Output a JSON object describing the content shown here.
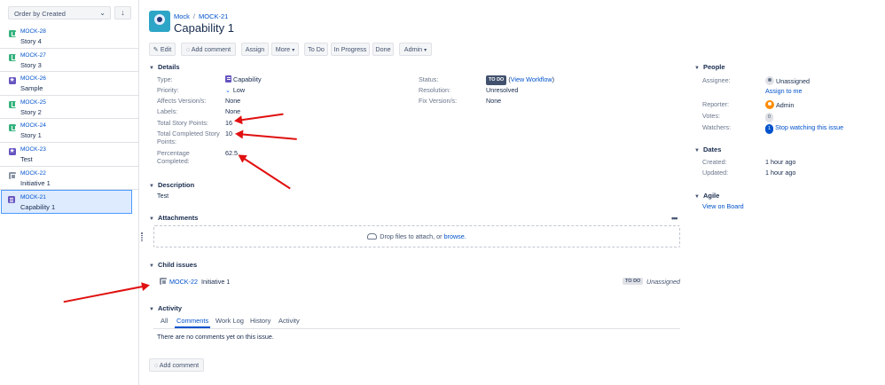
{
  "sidebar": {
    "order_label": "Order by Created",
    "order_direction_icon": "arrow-down-icon",
    "issues": [
      {
        "key": "MOCK-28",
        "summary": "Story 4",
        "type": "story"
      },
      {
        "key": "MOCK-27",
        "summary": "Story 3",
        "type": "story"
      },
      {
        "key": "MOCK-26",
        "summary": "Sample",
        "type": "epic"
      },
      {
        "key": "MOCK-25",
        "summary": "Story 2",
        "type": "story"
      },
      {
        "key": "MOCK-24",
        "summary": "Story 1",
        "type": "story"
      },
      {
        "key": "MOCK-23",
        "summary": "Test",
        "type": "epic"
      },
      {
        "key": "MOCK-22",
        "summary": "Initiative 1",
        "type": "initiative"
      },
      {
        "key": "MOCK-21",
        "summary": "Capability 1",
        "type": "capability",
        "selected": true
      }
    ]
  },
  "header": {
    "project": "Mock",
    "issue_key": "MOCK-21",
    "title": "Capability 1"
  },
  "toolbar": {
    "edit": "Edit",
    "add_comment": "Add comment",
    "assign": "Assign",
    "more": "More",
    "to_do": "To Do",
    "in_progress": "In Progress",
    "done": "Done",
    "admin": "Admin"
  },
  "details": {
    "heading": "Details",
    "type_label": "Type:",
    "type_value": "Capability",
    "priority_label": "Priority:",
    "priority_value": "Low",
    "affects_label": "Affects Version/s:",
    "affects_value": "None",
    "labels_label": "Labels:",
    "labels_value": "None",
    "tsp_label": "Total Story Points:",
    "tsp_value": "16",
    "tcsp_label_1": "Total Completed Story",
    "tcsp_label_2": "Points:",
    "tcsp_value": "10",
    "pct_label_1": "Percentage",
    "pct_label_2": "Completed:",
    "pct_value": "62.5",
    "status_label": "Status:",
    "status_value": "TO DO",
    "view_workflow": "View Workflow",
    "resolution_label": "Resolution:",
    "resolution_value": "Unresolved",
    "fix_label": "Fix Version/s:",
    "fix_value": "None"
  },
  "description": {
    "heading": "Description",
    "text": "Test"
  },
  "attachments": {
    "heading": "Attachments",
    "more": "•••",
    "drop_text": "Drop files to attach, or",
    "browse": "browse."
  },
  "child_issues": {
    "heading": "Child issues",
    "rows": [
      {
        "key": "MOCK-22",
        "summary": "Initiative 1",
        "status": "TO DO",
        "assignee": "Unassigned"
      }
    ]
  },
  "activity": {
    "heading": "Activity",
    "tabs": [
      "All",
      "Comments",
      "Work Log",
      "History",
      "Activity"
    ],
    "active_tab": "Comments",
    "empty": "There are no comments yet on this issue.",
    "add_comment": "Add comment"
  },
  "people": {
    "heading": "People",
    "assignee_label": "Assignee:",
    "assignee_value": "Unassigned",
    "assign_to_me": "Assign to me",
    "reporter_label": "Reporter:",
    "reporter_value": "Admin",
    "votes_label": "Votes:",
    "votes_value": "0",
    "watchers_label": "Watchers:",
    "watchers_value": "1",
    "stop_watching": "Stop watching this issue"
  },
  "dates": {
    "heading": "Dates",
    "created_label": "Created:",
    "created_value": "1 hour ago",
    "updated_label": "Updated:",
    "updated_value": "1 hour ago"
  },
  "agile": {
    "heading": "Agile",
    "view_on_board": "View on Board"
  },
  "colors": {
    "link": "#0052cc",
    "annotation_arrow": "#e01010",
    "selected_row": "#deebff"
  }
}
